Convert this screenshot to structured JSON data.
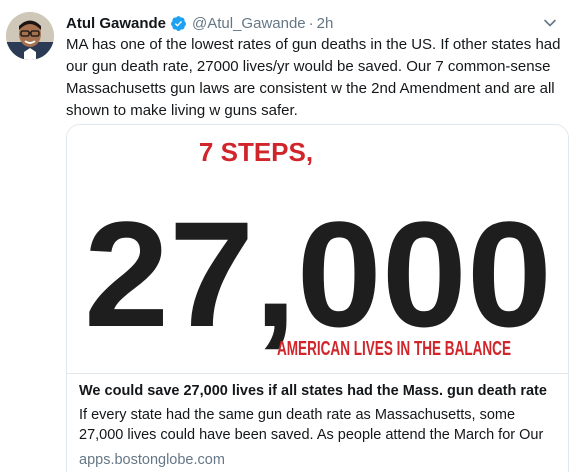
{
  "tweet": {
    "author_name": "Atul Gawande",
    "handle": "@Atul_Gawande",
    "separator": "·",
    "time": "2h",
    "text": "MA has one of the lowest rates of gun deaths in the US. If other states had our gun death rate, 27000 lives/yr would be saved. Our 7 common-sense Massachusetts gun laws are consistent w the 2nd Amendment and are all shown to make living w guns safer."
  },
  "card": {
    "image_top_text": "7 STEPS,",
    "image_big_number": "27,000",
    "image_bottom_text": "AMERICAN LIVES IN THE BALANCE",
    "title": "We could save 27,000 lives if all states had the Mass. gun death rate",
    "description": "If every state had the same gun death rate as Massachusetts, some 27,000 lives could have been saved. As people attend the March for Our Lives, h...",
    "domain": "apps.bostonglobe.com"
  },
  "colors": {
    "accent_red": "#d0262b",
    "verified_blue": "#1da1f2",
    "secondary_text": "#657786",
    "big_number": "#1e1e1e"
  },
  "icons": {
    "verified": "verified-badge-icon",
    "caret": "chevron-down-icon"
  }
}
